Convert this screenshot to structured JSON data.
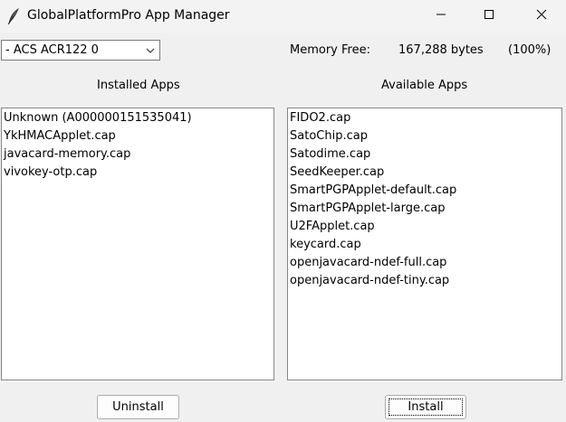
{
  "window": {
    "title": "GlobalPlatformPro App Manager",
    "controls": {
      "minimize_icon": "minimize-icon",
      "maximize_icon": "maximize-icon",
      "close_icon": "close-icon"
    }
  },
  "reader": {
    "selected": "- ACS ACR122 0",
    "arrow_icon": "chevron-down-icon"
  },
  "memory": {
    "label": "Memory Free:",
    "value": "167,288 bytes",
    "percent": "(100%)"
  },
  "installed": {
    "heading": "Installed Apps",
    "items": [
      "Unknown (A000000151535041)",
      "YkHMACApplet.cap",
      "javacard-memory.cap",
      "vivokey-otp.cap"
    ]
  },
  "available": {
    "heading": "Available Apps",
    "items": [
      "FIDO2.cap",
      "SatoChip.cap",
      "Satodime.cap",
      "SeedKeeper.cap",
      "SmartPGPApplet-default.cap",
      "SmartPGPApplet-large.cap",
      "U2FApplet.cap",
      "keycard.cap",
      "openjavacard-ndef-full.cap",
      "openjavacard-ndef-tiny.cap"
    ]
  },
  "buttons": {
    "uninstall": "Uninstall",
    "install": "Install"
  }
}
